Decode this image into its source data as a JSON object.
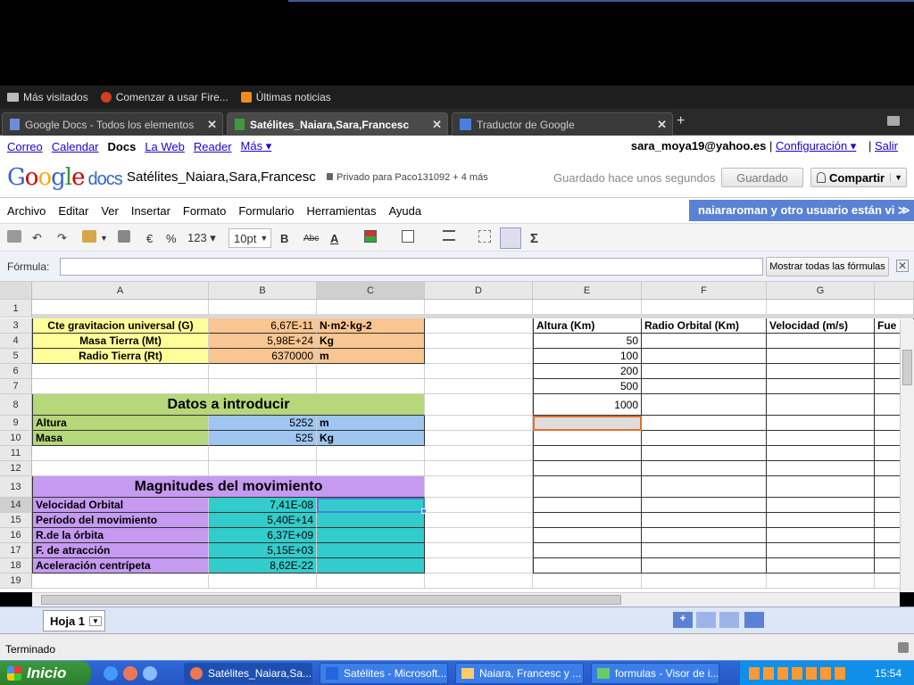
{
  "browser": {
    "bookmarks": [
      "Más visitados",
      "Comenzar a usar Fire...",
      "Últimas noticias"
    ],
    "tabs": [
      {
        "label": "Google Docs - Todos los elementos"
      },
      {
        "label": "Satélites_Naiara,Sara,Francesc"
      },
      {
        "label": "Traductor de Google"
      }
    ]
  },
  "gbar": {
    "links": [
      "Correo",
      "Calendar",
      "Docs",
      "La Web",
      "Reader",
      "Más ▾"
    ],
    "user": "sara_moya19@yahoo.es",
    "config": "Configuración ▾",
    "sep": "|",
    "logout": "Salir"
  },
  "header": {
    "docs": "docs",
    "title": "Satélites_Naiara,Sara,Francesc",
    "privacy": "Privado para Paco131092 + 4 más",
    "saved_status": "Guardado hace unos segundos",
    "saved_button": "Guardado",
    "share_button": "Compartir"
  },
  "menu": [
    "Archivo",
    "Editar",
    "Ver",
    "Insertar",
    "Formato",
    "Formulario",
    "Herramientas",
    "Ayuda"
  ],
  "collab_banner": "naiararoman y otro usuario están vi ≫",
  "toolbar": {
    "euro": "€",
    "percent": "%",
    "numfmt": "123 ▾",
    "fontsize": "10pt",
    "bold": "B",
    "strike": "Abc",
    "fontcolor": "A",
    "sum": "Σ"
  },
  "formula": {
    "label": "Fórmula:",
    "value": "",
    "show_all": "Mostrar todas las fórmulas"
  },
  "columns": [
    "A",
    "B",
    "C",
    "D",
    "E",
    "F",
    "G"
  ],
  "rows": [
    "1",
    "3",
    "4",
    "5",
    "6",
    "7",
    "8",
    "9",
    "10",
    "11",
    "12",
    "13",
    "14",
    "15",
    "16",
    "17",
    "18",
    "19"
  ],
  "cells": {
    "a3": "Cte gravitacion universal (G)",
    "b3": "6,67E-11",
    "c3": "N·m2·kg-2",
    "a4": "Masa Tierra (Mt)",
    "b4": "5,98E+24",
    "c4": "Kg",
    "a5": "Radio Tierra (Rt)",
    "b5": "6370000",
    "c5": "m",
    "a8": "Datos a introducir",
    "a9": "Altura",
    "b9": "5252",
    "c9": "m",
    "a10": "Masa",
    "b10": "525",
    "c10": "Kg",
    "a13": "Magnitudes del movimiento",
    "a14": "Velocidad Orbital",
    "b14": "7,41E-08",
    "a15": "Período del movimiento",
    "b15": "5,40E+14",
    "a16": "R.de la órbita",
    "b16": "6,37E+09",
    "a17": "F. de atracción",
    "b17": "5,15E+03",
    "a18": "Aceleración centrípeta",
    "b18": "8,62E-22",
    "e3": "Altura (Km)",
    "f3": "Radio Orbital (Km)",
    "g3": "Velocidad (m/s)",
    "h3": "Fue",
    "e4": "50",
    "e5": "100",
    "e6": "200",
    "e7": "500",
    "e8": "1000"
  },
  "sheet": {
    "name": "Hoja 1"
  },
  "status": "Terminado",
  "taskbar": {
    "start": "Inicio",
    "tasks": [
      "Satélites_Naiara,Sa...",
      "Satélites - Microsoft...",
      "Naiara, Francesc y ...",
      "formulas - Visor de i..."
    ],
    "clock": "15:54"
  }
}
